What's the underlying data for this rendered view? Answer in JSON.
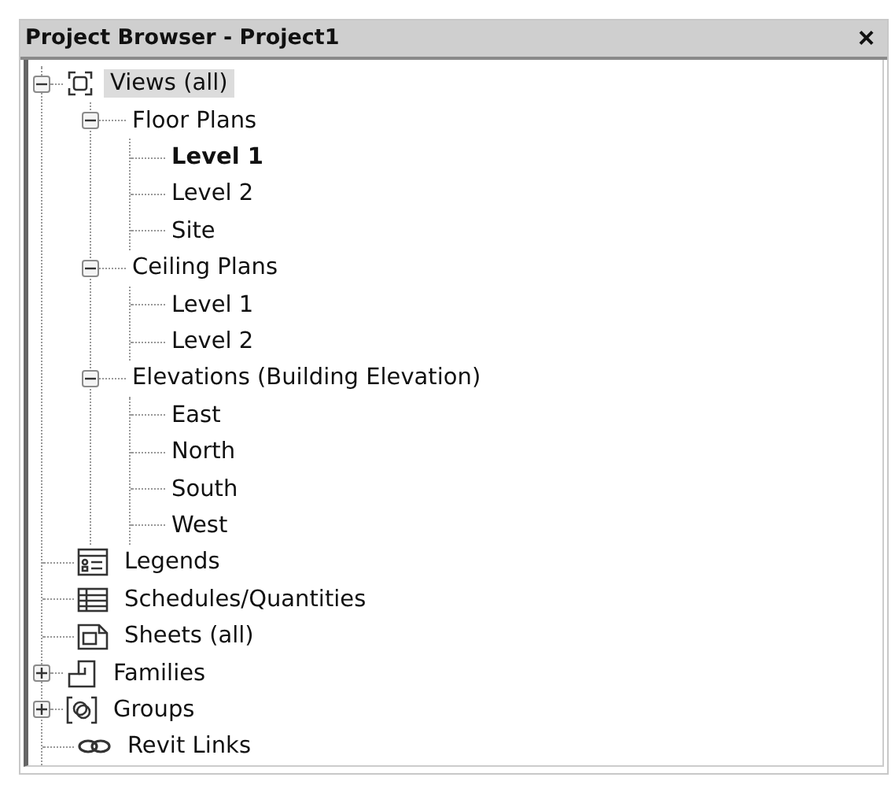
{
  "panel": {
    "title": "Project Browser - Project1",
    "close": "×"
  },
  "tree": [
    {
      "label": "Views (all)",
      "kind": "views",
      "expanded": true,
      "selected": true,
      "children": [
        {
          "label": "Floor Plans",
          "expanded": true,
          "selected": false,
          "children": [
            {
              "label": "Level 1",
              "current": true,
              "selected": false
            },
            {
              "label": "Level 2",
              "current": false,
              "selected": false
            },
            {
              "label": "Site",
              "current": false,
              "selected": false
            }
          ]
        },
        {
          "label": "Ceiling Plans",
          "expanded": true,
          "selected": false,
          "children": [
            {
              "label": "Level 1",
              "current": false,
              "selected": false
            },
            {
              "label": "Level 2",
              "current": false,
              "selected": false
            }
          ]
        },
        {
          "label": "Elevations (Building Elevation)",
          "expanded": true,
          "selected": false,
          "children": [
            {
              "label": "East",
              "current": false,
              "selected": false
            },
            {
              "label": "North",
              "current": false,
              "selected": false
            },
            {
              "label": "South",
              "current": false,
              "selected": false
            },
            {
              "label": "West",
              "current": false,
              "selected": false
            }
          ]
        }
      ]
    },
    {
      "label": "Legends",
      "kind": "legends",
      "selected": false
    },
    {
      "label": "Schedules/Quantities",
      "kind": "schedules",
      "selected": false
    },
    {
      "label": "Sheets (all)",
      "kind": "sheets",
      "selected": false
    },
    {
      "label": "Families",
      "kind": "families",
      "expanded": false,
      "selected": false
    },
    {
      "label": "Groups",
      "kind": "groups",
      "expanded": false,
      "selected": false
    },
    {
      "label": "Revit Links",
      "kind": "links",
      "selected": false
    }
  ]
}
